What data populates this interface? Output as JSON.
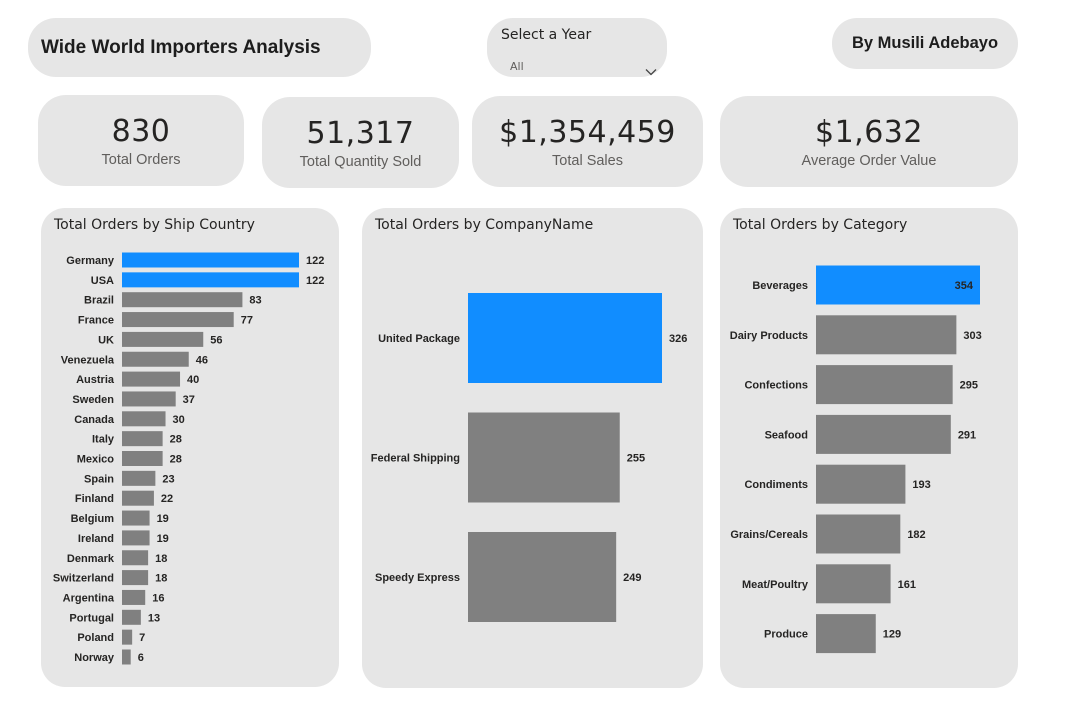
{
  "header": {
    "title": "Wide World Importers Analysis",
    "author": "By Musili Adebayo"
  },
  "slicer": {
    "title": "Select a Year",
    "value": "All"
  },
  "kpis": {
    "orders": {
      "value": "830",
      "label": "Total Orders"
    },
    "quantity": {
      "value": "51,317",
      "label": "Total Quantity Sold"
    },
    "sales": {
      "value": "$1,354,459",
      "label": "Total Sales"
    },
    "aov": {
      "value": "$1,632",
      "label": "Average Order Value"
    }
  },
  "colors": {
    "highlight": "#118dff",
    "bar": "#808080",
    "card": "#e6e6e6"
  },
  "icons": {
    "dropdown": "chevron-down-icon"
  },
  "chart_data": [
    {
      "type": "bar",
      "orientation": "horizontal",
      "title": "Total Orders by Ship Country",
      "categories": [
        "Germany",
        "USA",
        "Brazil",
        "France",
        "UK",
        "Venezuela",
        "Austria",
        "Sweden",
        "Canada",
        "Italy",
        "Mexico",
        "Spain",
        "Finland",
        "Belgium",
        "Ireland",
        "Denmark",
        "Switzerland",
        "Argentina",
        "Portugal",
        "Poland",
        "Norway"
      ],
      "values": [
        122,
        122,
        83,
        77,
        56,
        46,
        40,
        37,
        30,
        28,
        28,
        23,
        22,
        19,
        19,
        18,
        18,
        16,
        13,
        7,
        6
      ],
      "highlighted": [
        "Germany",
        "USA"
      ],
      "xlim": [
        0,
        122
      ]
    },
    {
      "type": "bar",
      "orientation": "horizontal",
      "title": "Total Orders by CompanyName",
      "categories": [
        "United Package",
        "Federal Shipping",
        "Speedy Express"
      ],
      "values": [
        326,
        255,
        249
      ],
      "highlighted": [
        "United Package"
      ],
      "xlim": [
        0,
        326
      ]
    },
    {
      "type": "bar",
      "orientation": "horizontal",
      "title": "Total Orders by Category",
      "categories": [
        "Beverages",
        "Dairy Products",
        "Confections",
        "Seafood",
        "Condiments",
        "Grains/Cereals",
        "Meat/Poultry",
        "Produce"
      ],
      "values": [
        354,
        303,
        295,
        291,
        193,
        182,
        161,
        129
      ],
      "highlighted": [
        "Beverages"
      ],
      "xlim": [
        0,
        354
      ],
      "label_inside_highlight": true
    }
  ]
}
